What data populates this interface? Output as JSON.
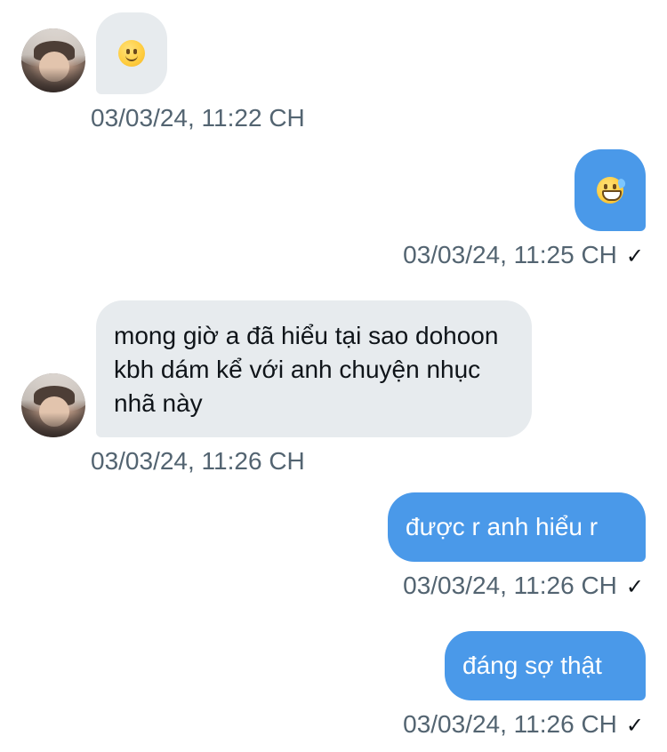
{
  "messages": [
    {
      "side": "in",
      "emoji": "slightly-smiling-face-icon",
      "timestamp": "03/03/24, 11:22 CH"
    },
    {
      "side": "out",
      "emoji": "grinning-face-with-sweat-icon",
      "timestamp": "03/03/24, 11:25 CH",
      "status": "✓"
    },
    {
      "side": "in",
      "text": "mong giờ a đã hiểu tại sao dohoon kbh dám kể với anh chuyện nhục nhã này",
      "timestamp": "03/03/24, 11:26 CH"
    },
    {
      "side": "out",
      "text": "được r anh hiểu r",
      "timestamp": "03/03/24, 11:26 CH",
      "status": "✓"
    },
    {
      "side": "out",
      "text": "đáng sợ thật",
      "timestamp": "03/03/24, 11:26 CH",
      "status": "✓"
    }
  ],
  "colors": {
    "incoming_bubble": "#e7ebee",
    "outgoing_bubble": "#4a99e9",
    "timestamp": "#536471"
  }
}
